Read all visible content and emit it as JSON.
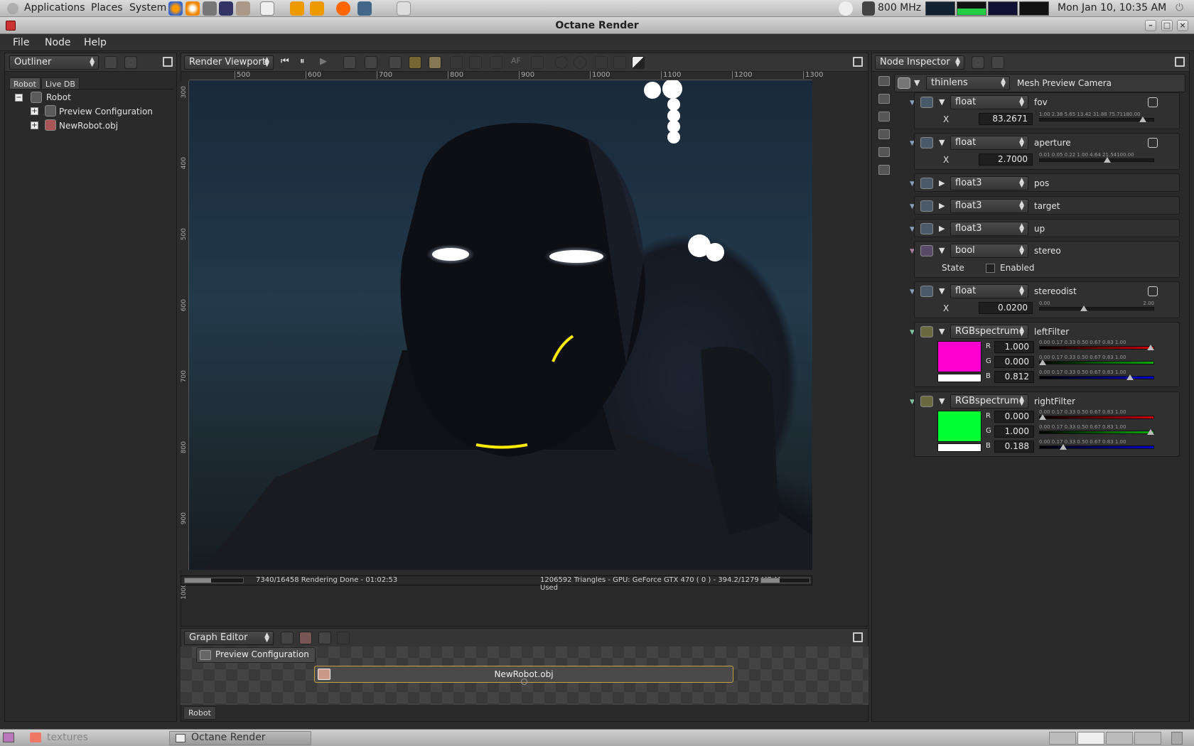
{
  "top_panel": {
    "menus": [
      "Applications",
      "Places",
      "System"
    ],
    "cpu_freq": "800 MHz",
    "clock": "Mon Jan 10, 10:35 AM"
  },
  "window": {
    "title": "Octane Render"
  },
  "menubar": [
    "File",
    "Node",
    "Help"
  ],
  "outliner": {
    "combo": "Outliner",
    "tabs": [
      "Robot",
      "Live DB"
    ],
    "tree": {
      "root": "Robot",
      "children": [
        "Preview Configuration",
        "NewRobot.obj"
      ]
    }
  },
  "viewport": {
    "combo": "Render Viewport",
    "toolbar_labels": [
      "AF"
    ],
    "ruler_h": [
      "500",
      "600",
      "700",
      "800",
      "900",
      "1000",
      "1100",
      "1200",
      "1300"
    ],
    "ruler_v": [
      "300",
      "400",
      "500",
      "600",
      "700",
      "800",
      "900",
      "1000"
    ],
    "status_left": "7340/16458 Rendering Done - 01:02:53",
    "status_right": "1206592 Triangles - GPU: GeForce GTX 470 ( 0 ) - 394.2/1279 MB Mem Used",
    "render_progress": 0.446
  },
  "graph_editor": {
    "combo": "Graph Editor",
    "node_preview": "Preview Configuration",
    "node_mesh": "NewRobot.obj",
    "tab": "Robot"
  },
  "inspector": {
    "combo": "Node Inspector",
    "camera_type": "thinlens",
    "camera_name": "Mesh Preview Camera",
    "params": {
      "fov": {
        "type": "float",
        "name": "fov",
        "axis": "X",
        "value": "83.2671",
        "ticks": "1.00  2.38   5.65   13.42  31.88  75.71180.00",
        "level": 0.93
      },
      "aperture": {
        "type": "float",
        "name": "aperture",
        "axis": "X",
        "value": "2.7000",
        "ticks": "0.01 0.05   0.22   1.00   4.64   21.54100.00",
        "level": 0.6
      },
      "pos": {
        "type": "float3",
        "name": "pos"
      },
      "target": {
        "type": "float3",
        "name": "target"
      },
      "up": {
        "type": "float3",
        "name": "up"
      },
      "stereo": {
        "type": "bool",
        "name": "stereo",
        "state_label": "State",
        "checkbox_label": "Enabled",
        "checked": false
      },
      "stereodist": {
        "type": "float",
        "name": "stereodist",
        "axis": "X",
        "value": "0.0200",
        "tick_min": "0.00",
        "tick_max": "2.00",
        "level": 0.38
      },
      "leftFilter": {
        "type": "RGBspectrum",
        "name": "leftFilter",
        "color": "#ff00d0",
        "channels": [
          {
            "label": "R",
            "value": "1.000",
            "level": 1.0
          },
          {
            "label": "G",
            "value": "0.000",
            "level": 0.0
          },
          {
            "label": "B",
            "value": "0.812",
            "level": 0.812
          }
        ]
      },
      "rightFilter": {
        "type": "RGBspectrum",
        "name": "rightFilter",
        "color": "#00ff30",
        "channels": [
          {
            "label": "R",
            "value": "0.000",
            "level": 0.0
          },
          {
            "label": "G",
            "value": "1.000",
            "level": 1.0
          },
          {
            "label": "B",
            "value": "0.188",
            "level": 0.188
          }
        ]
      }
    },
    "rgb_ticks": "0.00 0.17  0.33  0.50  0.67  0.83 1.00"
  },
  "taskbar": {
    "items": [
      "textures",
      "Octane Render"
    ]
  },
  "colors": {
    "panel_bg": "#2a2a2a",
    "accent_magenta": "#ff00d0",
    "accent_green": "#00ff30",
    "selection_gold": "#c8a040"
  }
}
